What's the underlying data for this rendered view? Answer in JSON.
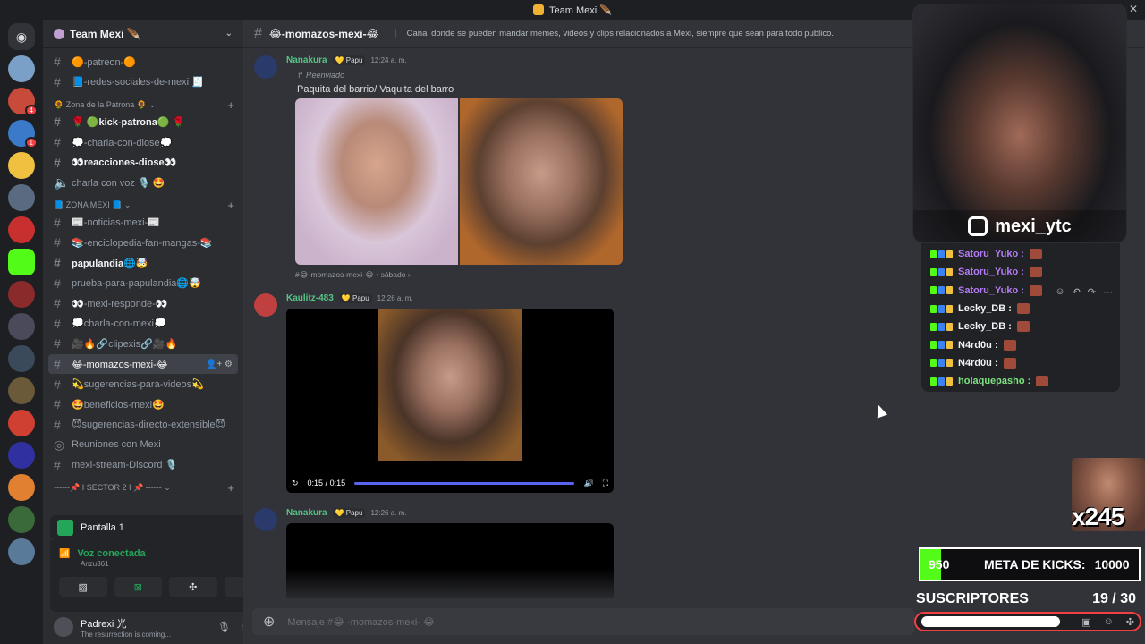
{
  "window": {
    "title": "Team Mexi 🪶",
    "close": "✕"
  },
  "server": {
    "name": "Team Mexi 🪶",
    "chevron": "⌄"
  },
  "guild_icons": {
    "home_icon": "discord-icon",
    "badge_1": "4",
    "badge_2": "1"
  },
  "channels": [
    {
      "label": "🟠-patreon-🟠"
    },
    {
      "label": "📘-redes-sociales-de-mexi 🧾"
    }
  ],
  "category_patrona": {
    "label": "🌻 Zona de la Patrona 🌻 ⌄",
    "plus": "+"
  },
  "channels_patrona": [
    {
      "label": "🌹 🟢kick-patrona🟢 🌹"
    },
    {
      "label": "💭-charla-con-diose💭"
    },
    {
      "label": "👀reacciones-diose👀"
    },
    {
      "label": "charla con voz 🎙️ 🤩"
    }
  ],
  "category_zona": {
    "label": "📘 ZONA MEXI 📘 ⌄",
    "plus": "+"
  },
  "channels_zona": [
    {
      "label": "📰-noticias-mexi-📰"
    },
    {
      "label": "📚-enciclopedia-fan-mangas-📚"
    },
    {
      "label": "papulandia🌐🤯"
    },
    {
      "label": "prueba-para-papulandia🌐🤯"
    },
    {
      "label": "👀-mexi-responde-👀"
    },
    {
      "label": "💭charla-con-mexi💭"
    },
    {
      "label": "🎥🔥🔗clipexis🔗🎥🔥"
    },
    {
      "label": "😂-momazos-mexi-😂",
      "tools": "👤+ ⚙"
    },
    {
      "label": "💫sugerencias-para-videos💫"
    },
    {
      "label": "🤩beneficios-mexi🤩"
    },
    {
      "label": "😈sugerencias-directo-extensible😈"
    },
    {
      "label": "Reuniones con Mexi"
    },
    {
      "label": "mexi-stream-Discord 🎙️"
    }
  ],
  "category_sector": {
    "label": "------📌 I SECTOR 2 I 📌 ------ ⌄",
    "plus": "+"
  },
  "panel": {
    "screen": "Pantalla 1",
    "voice_status": "Voz conectada",
    "voice_channel": "Anzu361",
    "user_name": "Padrexi 光",
    "user_status": "The resurrection is coming..."
  },
  "channel_header": {
    "name": "😂-momazos-mexi-😂",
    "topic": "Canal donde se pueden mandar memes, videos y clips relacionados a Mexi, siempre que sean para todo publico."
  },
  "messages": [
    {
      "author": "Nanakura",
      "role": "💛 Papu",
      "time": "12:24 a. m.",
      "forwarded": "↱ Reenviado",
      "text": "Paquita del barrio/ Vaquita del barro",
      "footer": "#😂-momazos-mexi-😂 • sábado ›"
    },
    {
      "author": "Kaulitz-483",
      "role": "💛 Papu",
      "time": "12:26 a. m.",
      "video_time": "0:15 / 0:15"
    },
    {
      "author": "Nanakura",
      "role": "💛 Papu",
      "time": "12:26 a. m."
    }
  ],
  "composer": {
    "placeholder": "Mensaje #😂 -momazos-mexi- 😂"
  },
  "stream_overlay": {
    "handle": "mexi_ytc",
    "chat": [
      {
        "name": "Satoru_Yuko :",
        "color": "#b57cf5"
      },
      {
        "name": "Satoru_Yuko :",
        "color": "#b57cf5"
      },
      {
        "name": "Satoru_Yuko :",
        "color": "#b57cf5"
      },
      {
        "name": "Lecky_DB :",
        "color": "#f2f3f5"
      },
      {
        "name": "Lecky_DB :",
        "color": "#f2f3f5"
      },
      {
        "name": "N4rd0u :",
        "color": "#f2f3f5"
      },
      {
        "name": "N4rd0u :",
        "color": "#f2f3f5"
      },
      {
        "name": "holaquepasho :",
        "color": "#7ee37e"
      }
    ],
    "multiplier": "x245",
    "kicks_current": "950",
    "kicks_label": "META DE KICKS:",
    "kicks_goal": "10000",
    "kicks_progress": 0.095,
    "subs_label": "SUSCRIPTORES",
    "subs_count": "19 / 30",
    "subs_progress": 0.63
  },
  "colors": {
    "accent": "#5865f2",
    "online": "#23a55a",
    "kick_green": "#53fc18",
    "danger": "#f23f43"
  }
}
